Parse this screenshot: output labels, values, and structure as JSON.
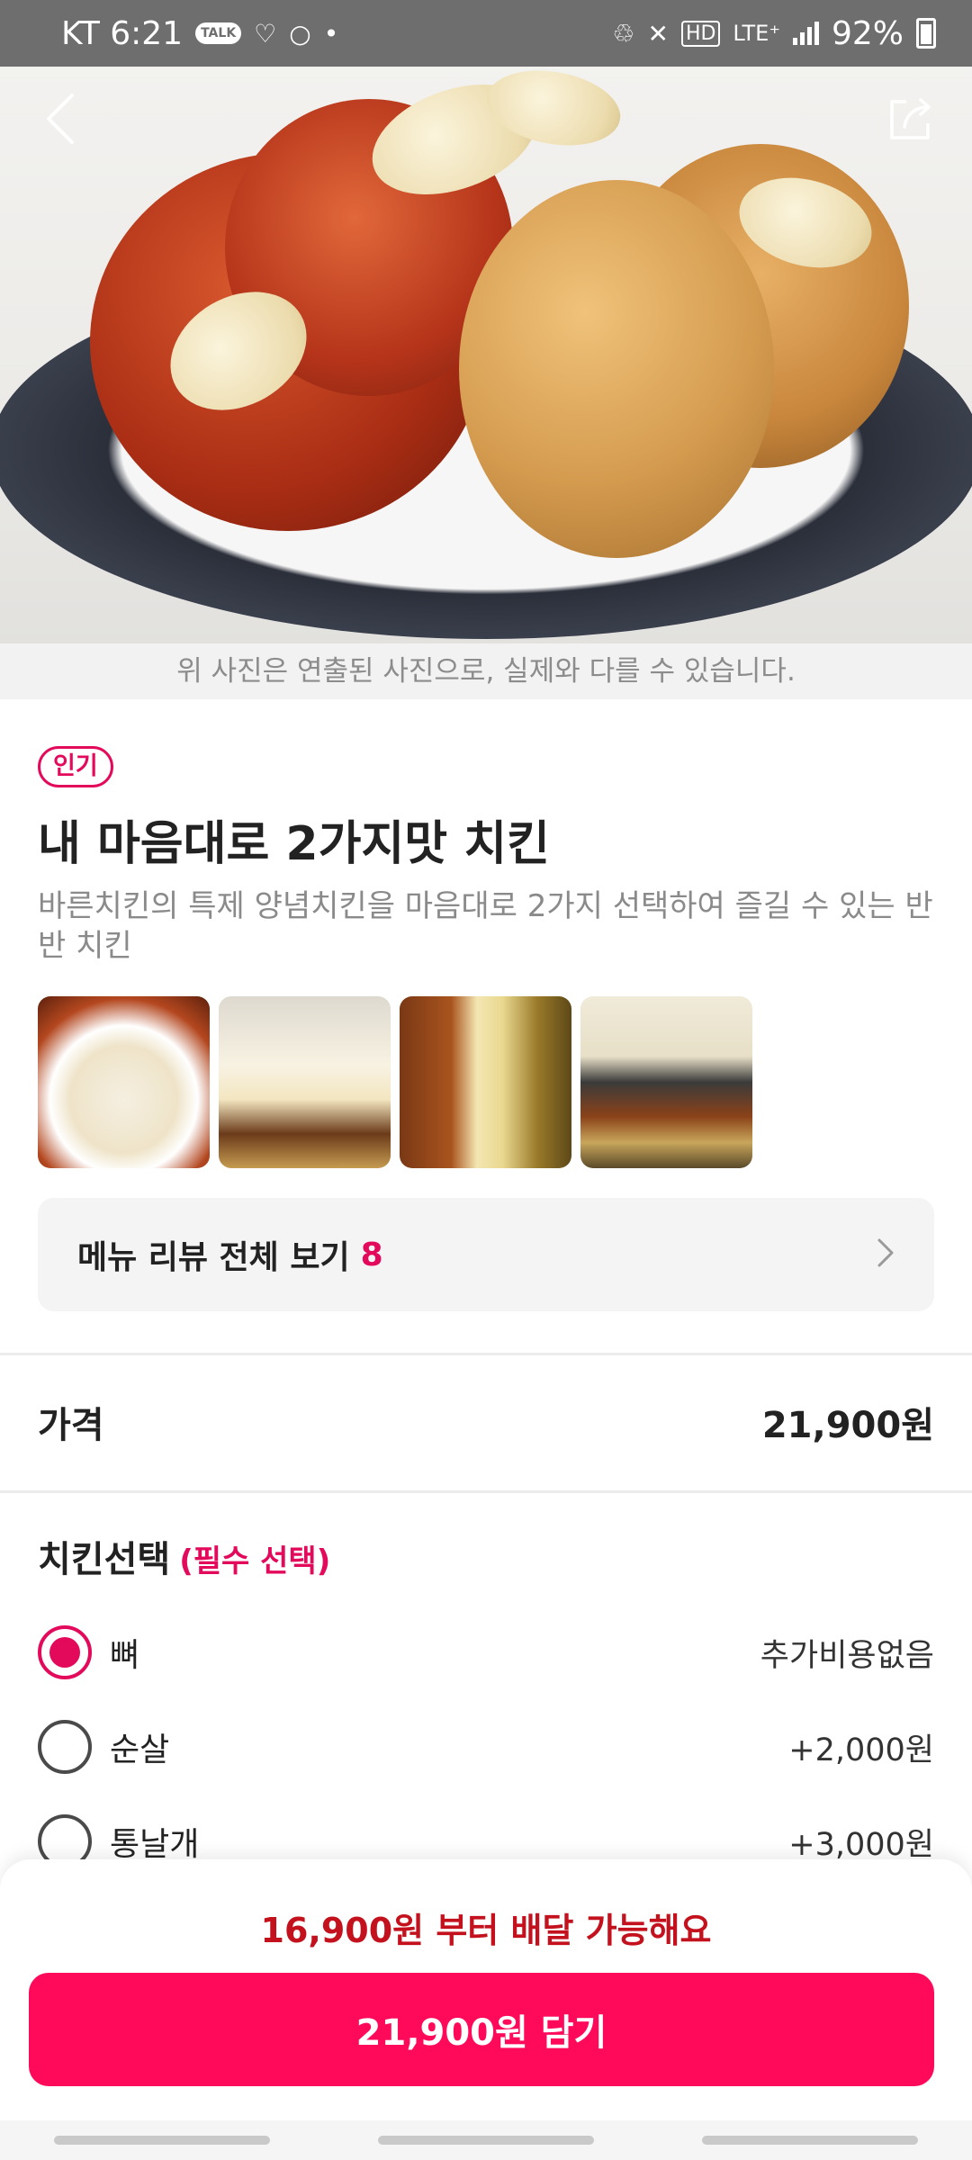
{
  "status_bar": {
    "carrier_time": "KT 6:21",
    "talk_badge": "TALK",
    "network": "LTE⁺",
    "hd": "HD",
    "battery": "92%"
  },
  "hero": {
    "photo_note": "위 사진은 연출된 사진으로, 실제와 다를 수 있습니다."
  },
  "menu": {
    "badge": "인기",
    "title": "내 마음대로 2가지맛 치킨",
    "description": "바른치킨의 특제 양념치킨을 마음대로 2가지 선택하여 즐길 수 있는 반반 치킨",
    "review_label": "메뉴 리뷰 전체 보기",
    "review_count": "8"
  },
  "price": {
    "label": "가격",
    "value": "21,900원"
  },
  "option_group": {
    "title": "치킨선택",
    "required": "(필수 선택)",
    "options": [
      {
        "label": "뼈",
        "price": "추가비용없음",
        "selected": true
      },
      {
        "label": "순살",
        "price": "+2,000원",
        "selected": false
      },
      {
        "label": "통날개",
        "price": "+3,000원",
        "selected": false
      }
    ]
  },
  "bottom": {
    "delivery_note": "16,900원 부터 배달 가능해요",
    "cart_button": "21,900원 담기"
  },
  "colors": {
    "accent": "#e30a5c",
    "button": "#ff0a5b",
    "delivery_note": "#c3121d"
  }
}
